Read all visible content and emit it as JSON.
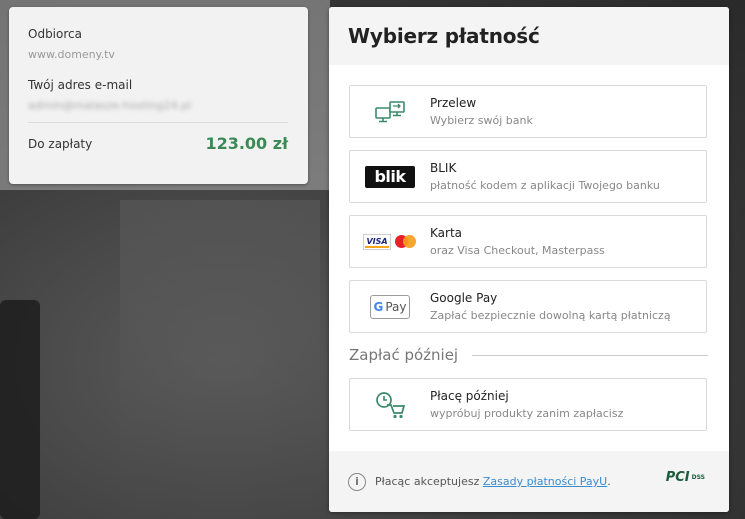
{
  "summary": {
    "recipient_label": "Odbiorca",
    "recipient_value": "www.domeny.tv",
    "email_label": "Twój adres e-mail",
    "email_value": "admin@malasze-hosting24.pl",
    "amount_label": "Do zapłaty",
    "amount_value": "123.00 zł"
  },
  "panel": {
    "title": "Wybierz płatność",
    "options": [
      {
        "title": "Przelew",
        "subtitle": "Wybierz swój bank",
        "icon": "bank-transfer-icon"
      },
      {
        "title": "BLIK",
        "subtitle": "płatność kodem z aplikacji Twojego banku",
        "icon": "blik-logo",
        "logo_text": "blik"
      },
      {
        "title": "Karta",
        "subtitle": "oraz Visa Checkout, Masterpass",
        "icon": "visa-mastercard-logos",
        "logo_text": "VISA"
      },
      {
        "title": "Google Pay",
        "subtitle": "Zapłać bezpiecznie dowolną kartą płatniczą",
        "icon": "google-pay-logo",
        "logo_g": "G",
        "logo_text": "Pay"
      }
    ],
    "later_heading": "Zapłać później",
    "later_option": {
      "title": "Płacę później",
      "subtitle": "wypróbuj produkty zanim zapłacisz",
      "icon": "cart-clock-icon"
    },
    "footer": {
      "text": "Płacąc akceptujesz ",
      "link": "Zasady płatności PayU",
      "suffix": ".",
      "badge_main": "PCI",
      "badge_sub": "DSS",
      "info_icon": "info-icon"
    }
  },
  "colors": {
    "amount": "#3b8a55",
    "link": "#3b8ccf",
    "transfer_icon": "#3a8a6a",
    "blik_bg": "#111111",
    "panel_head_bg": "#f4f4f4"
  }
}
